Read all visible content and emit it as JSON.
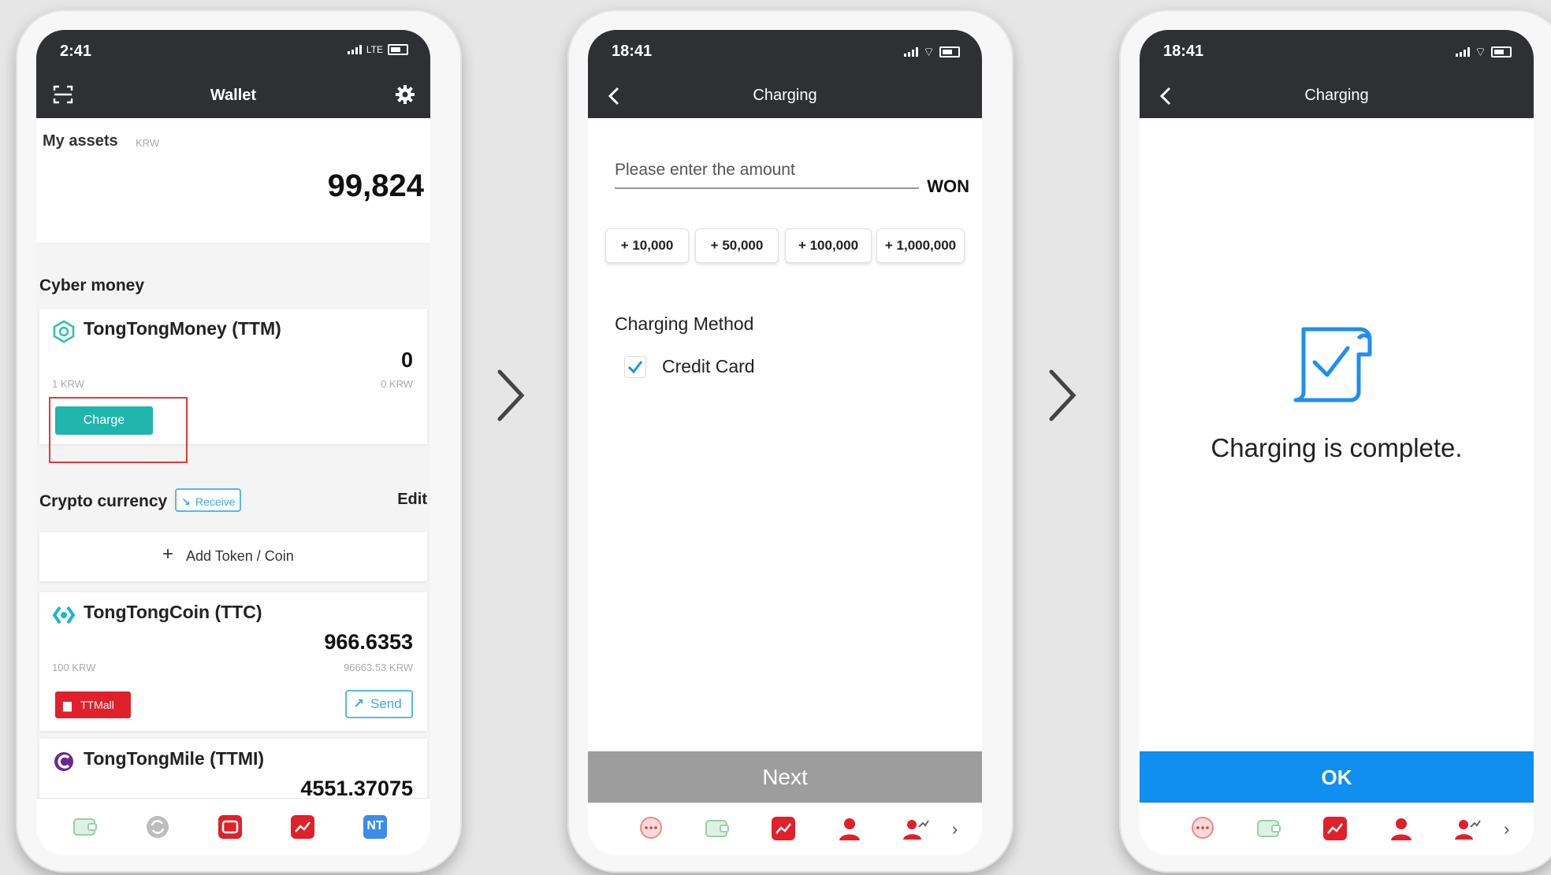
{
  "screen1": {
    "time": "2:41",
    "network": "LTE",
    "title": "Wallet",
    "my_assets_label": "My assets",
    "my_assets_unit": "KRW",
    "total": "99,824",
    "cyber_money_label": "Cyber money",
    "ttm_name": "TongTongMoney (TTM)",
    "ttm_amount": "0",
    "ttm_rate": "1 KRW",
    "ttm_krw": "0 KRW",
    "charge_label": "Charge",
    "crypto_label": "Crypto currency",
    "receive_label": "Receive",
    "edit_label": "Edit",
    "add_token_label": "Add Token / Coin",
    "ttc_name": "TongTongCoin (TTC)",
    "ttc_amount": "966.6353",
    "ttc_rate": "100 KRW",
    "ttc_krw": "96663.53 KRW",
    "ttmall_label": "TTMall",
    "send_label": "Send",
    "ttmi_name": "TongTongMile (TTMI)",
    "ttmi_amount": "4551.37075",
    "nt_label": "NT"
  },
  "screen2": {
    "time": "18:41",
    "title": "Charging",
    "amount_placeholder": "Please enter the amount",
    "currency": "WON",
    "chips": [
      "+ 10,000",
      "+ 50,000",
      "+ 100,000",
      "+ 1,000,000"
    ],
    "method_label": "Charging Method",
    "method_option": "Credit Card",
    "next_label": "Next"
  },
  "screen3": {
    "time": "18:41",
    "title": "Charging",
    "message": "Charging is complete.",
    "ok_label": "OK"
  },
  "colors": {
    "header": "#2f3033",
    "teal": "#1fb5ad",
    "blue_button": "#0f8ff0",
    "next_button": "#9d9d9d",
    "red_icon": "#e0202a",
    "highlight": "#e53935"
  }
}
